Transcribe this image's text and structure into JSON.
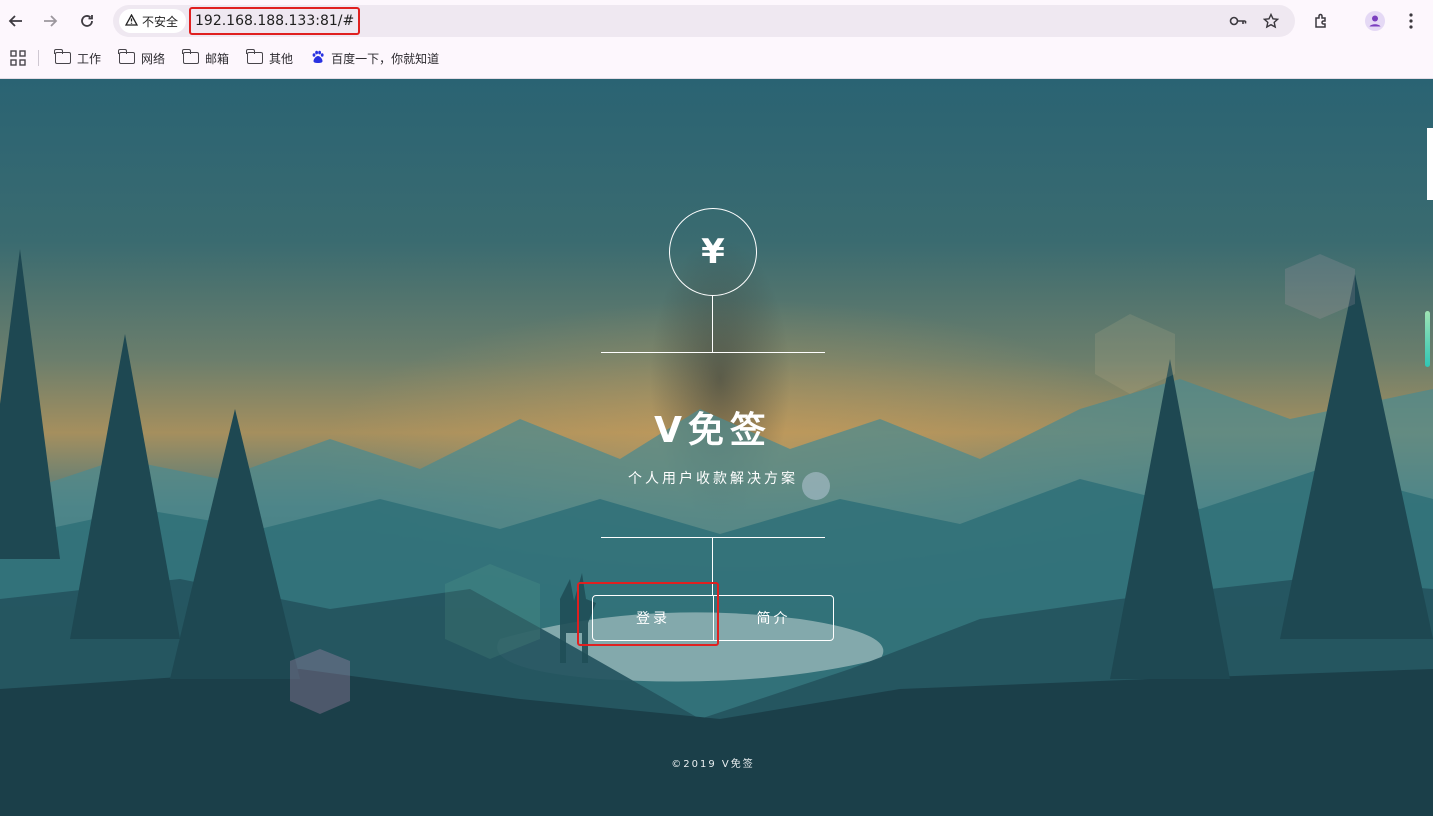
{
  "browser": {
    "security_label": "不安全",
    "url": "192.168.188.133:81/#",
    "bookmarks": [
      {
        "label": "工作",
        "icon": "folder-icon"
      },
      {
        "label": "网络",
        "icon": "folder-icon"
      },
      {
        "label": "邮箱",
        "icon": "folder-icon"
      },
      {
        "label": "其他",
        "icon": "folder-icon"
      },
      {
        "label": "百度一下，你就知道",
        "icon": "baidu-paw-icon"
      }
    ]
  },
  "hero": {
    "logo_symbol": "¥",
    "title": "V免签",
    "subtitle": "个人用户收款解决方案",
    "buttons": {
      "login": "登录",
      "intro": "简介"
    }
  },
  "footer": {
    "copyright": "©2019 V免签"
  },
  "colors": {
    "highlight_box": "#e02020",
    "chrome_background": "#fdf7fd",
    "omnibox_background": "#efe8f1"
  }
}
